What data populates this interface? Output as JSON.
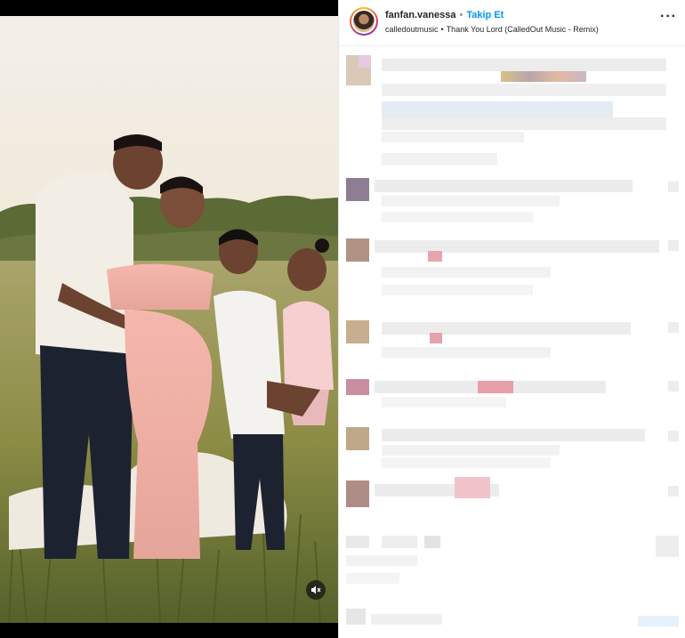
{
  "post": {
    "username": "fanfan.vanessa",
    "separator": "•",
    "follow_label": "Takip Et",
    "audio_artist": "calledoutmusic",
    "audio_separator": "•",
    "audio_track": "Thank You Lord (CalledOut Music - Remix)"
  },
  "media": {
    "type": "image",
    "mute_icon": "speaker-muted-icon"
  },
  "header": {
    "more_icon": "more-options-icon",
    "more_label": "···"
  },
  "comments_state": "pixelated"
}
